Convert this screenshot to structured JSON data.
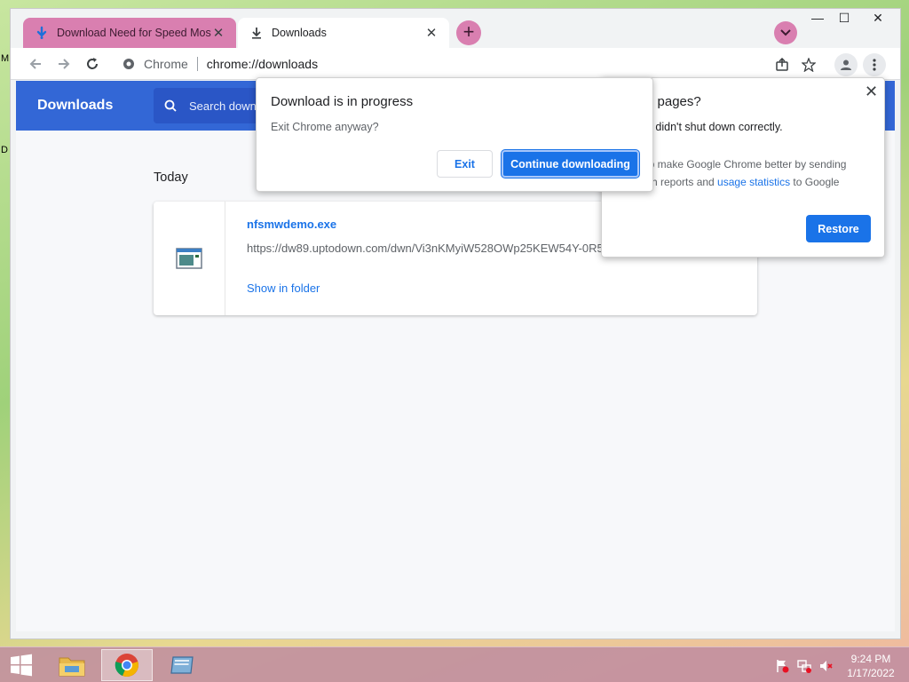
{
  "desktop": {
    "edge_text_1": "M",
    "edge_text_2": "D"
  },
  "tabs": [
    {
      "title": "Download Need for Speed Most",
      "icon": "uptodown-icon",
      "active": false
    },
    {
      "title": "Downloads",
      "icon": "download-icon",
      "active": true
    }
  ],
  "toolbar": {
    "site_label": "Chrome",
    "url": "chrome://downloads"
  },
  "downloads_page": {
    "title": "Downloads",
    "search_placeholder": "Search downloads",
    "date_header": "Today",
    "item": {
      "filename": "nfsmwdemo.exe",
      "url": "https://dw89.uptodown.com/dwn/Vi3nKMyiW528OWp25KEW54Y-0R5",
      "action": "Show in folder"
    }
  },
  "exit_dialog": {
    "title": "Download is in progress",
    "subtitle": "Exit Chrome anyway?",
    "exit_label": "Exit",
    "continue_label": "Continue downloading"
  },
  "restore_dialog": {
    "title": "e pages?",
    "message": "e didn't shut down correctly.",
    "help_prefix": "lp make Google Chrome better by sending",
    "help_line2_prefix": "sh reports and ",
    "help_link": "usage statistics",
    "help_suffix": " to Google",
    "restore_label": "Restore"
  },
  "taskbar": {
    "time": "9:24 PM",
    "date": "1/17/2022"
  },
  "colors": {
    "accent": "#1a73e8",
    "header": "#3367d6",
    "tab_theme": "#d97fb0"
  }
}
